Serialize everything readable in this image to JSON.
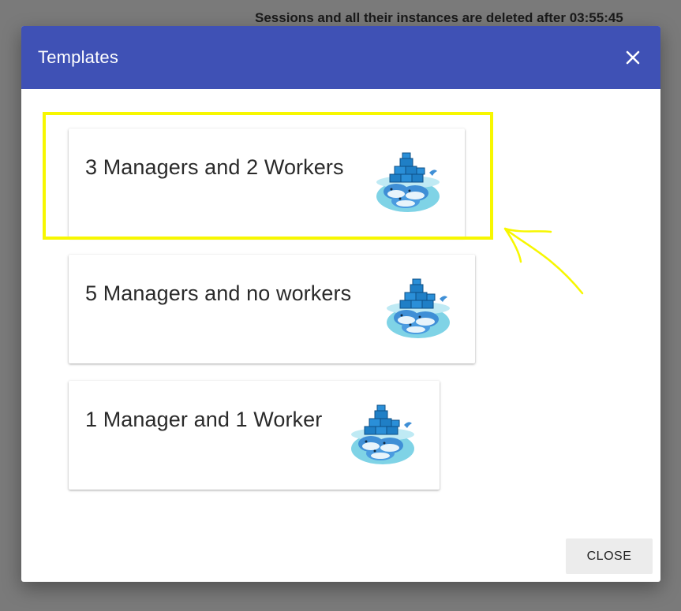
{
  "banner": {
    "text": "Sessions and all their instances are deleted after 03:55:45"
  },
  "dialog": {
    "title": "Templates",
    "close_icon": "close-icon",
    "close_label": "CLOSE"
  },
  "templates": [
    {
      "label": "3 Managers and 2 Workers",
      "icon": "docker-whale-icon"
    },
    {
      "label": "5 Managers and no workers",
      "icon": "docker-whale-icon"
    },
    {
      "label": "1 Manager and 1 Worker",
      "icon": "docker-whale-icon"
    }
  ],
  "annotation": {
    "color": "#f7f700",
    "highlight_target": "3 Managers and 2 Workers"
  },
  "colors": {
    "header": "#3f51b5",
    "backdrop": "#7a7a7a"
  }
}
